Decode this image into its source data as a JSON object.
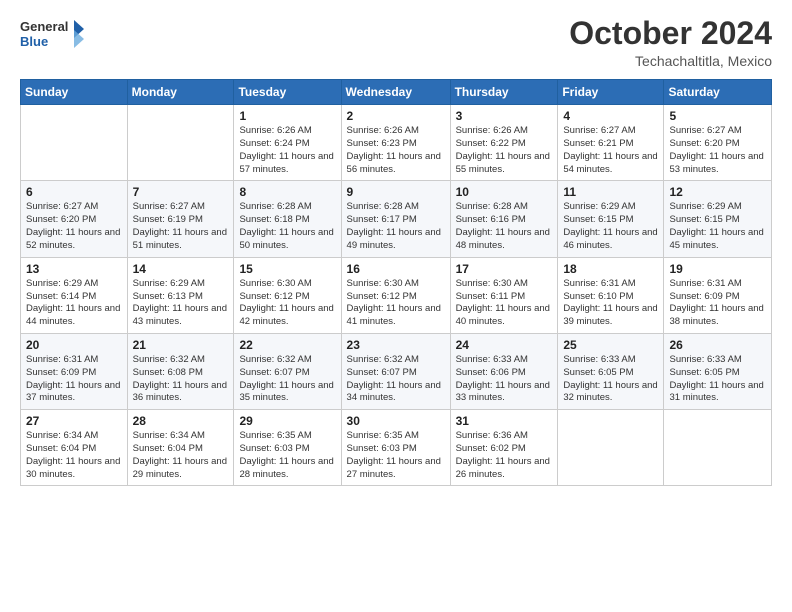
{
  "logo": {
    "line1": "General",
    "line2": "Blue"
  },
  "header": {
    "month": "October 2024",
    "location": "Techachaltitla, Mexico"
  },
  "weekdays": [
    "Sunday",
    "Monday",
    "Tuesday",
    "Wednesday",
    "Thursday",
    "Friday",
    "Saturday"
  ],
  "weeks": [
    [
      null,
      null,
      {
        "day": "1",
        "sunrise": "6:26 AM",
        "sunset": "6:24 PM",
        "daylight": "11 hours and 57 minutes."
      },
      {
        "day": "2",
        "sunrise": "6:26 AM",
        "sunset": "6:23 PM",
        "daylight": "11 hours and 56 minutes."
      },
      {
        "day": "3",
        "sunrise": "6:26 AM",
        "sunset": "6:22 PM",
        "daylight": "11 hours and 55 minutes."
      },
      {
        "day": "4",
        "sunrise": "6:27 AM",
        "sunset": "6:21 PM",
        "daylight": "11 hours and 54 minutes."
      },
      {
        "day": "5",
        "sunrise": "6:27 AM",
        "sunset": "6:20 PM",
        "daylight": "11 hours and 53 minutes."
      }
    ],
    [
      {
        "day": "6",
        "sunrise": "6:27 AM",
        "sunset": "6:20 PM",
        "daylight": "11 hours and 52 minutes."
      },
      {
        "day": "7",
        "sunrise": "6:27 AM",
        "sunset": "6:19 PM",
        "daylight": "11 hours and 51 minutes."
      },
      {
        "day": "8",
        "sunrise": "6:28 AM",
        "sunset": "6:18 PM",
        "daylight": "11 hours and 50 minutes."
      },
      {
        "day": "9",
        "sunrise": "6:28 AM",
        "sunset": "6:17 PM",
        "daylight": "11 hours and 49 minutes."
      },
      {
        "day": "10",
        "sunrise": "6:28 AM",
        "sunset": "6:16 PM",
        "daylight": "11 hours and 48 minutes."
      },
      {
        "day": "11",
        "sunrise": "6:29 AM",
        "sunset": "6:15 PM",
        "daylight": "11 hours and 46 minutes."
      },
      {
        "day": "12",
        "sunrise": "6:29 AM",
        "sunset": "6:15 PM",
        "daylight": "11 hours and 45 minutes."
      }
    ],
    [
      {
        "day": "13",
        "sunrise": "6:29 AM",
        "sunset": "6:14 PM",
        "daylight": "11 hours and 44 minutes."
      },
      {
        "day": "14",
        "sunrise": "6:29 AM",
        "sunset": "6:13 PM",
        "daylight": "11 hours and 43 minutes."
      },
      {
        "day": "15",
        "sunrise": "6:30 AM",
        "sunset": "6:12 PM",
        "daylight": "11 hours and 42 minutes."
      },
      {
        "day": "16",
        "sunrise": "6:30 AM",
        "sunset": "6:12 PM",
        "daylight": "11 hours and 41 minutes."
      },
      {
        "day": "17",
        "sunrise": "6:30 AM",
        "sunset": "6:11 PM",
        "daylight": "11 hours and 40 minutes."
      },
      {
        "day": "18",
        "sunrise": "6:31 AM",
        "sunset": "6:10 PM",
        "daylight": "11 hours and 39 minutes."
      },
      {
        "day": "19",
        "sunrise": "6:31 AM",
        "sunset": "6:09 PM",
        "daylight": "11 hours and 38 minutes."
      }
    ],
    [
      {
        "day": "20",
        "sunrise": "6:31 AM",
        "sunset": "6:09 PM",
        "daylight": "11 hours and 37 minutes."
      },
      {
        "day": "21",
        "sunrise": "6:32 AM",
        "sunset": "6:08 PM",
        "daylight": "11 hours and 36 minutes."
      },
      {
        "day": "22",
        "sunrise": "6:32 AM",
        "sunset": "6:07 PM",
        "daylight": "11 hours and 35 minutes."
      },
      {
        "day": "23",
        "sunrise": "6:32 AM",
        "sunset": "6:07 PM",
        "daylight": "11 hours and 34 minutes."
      },
      {
        "day": "24",
        "sunrise": "6:33 AM",
        "sunset": "6:06 PM",
        "daylight": "11 hours and 33 minutes."
      },
      {
        "day": "25",
        "sunrise": "6:33 AM",
        "sunset": "6:05 PM",
        "daylight": "11 hours and 32 minutes."
      },
      {
        "day": "26",
        "sunrise": "6:33 AM",
        "sunset": "6:05 PM",
        "daylight": "11 hours and 31 minutes."
      }
    ],
    [
      {
        "day": "27",
        "sunrise": "6:34 AM",
        "sunset": "6:04 PM",
        "daylight": "11 hours and 30 minutes."
      },
      {
        "day": "28",
        "sunrise": "6:34 AM",
        "sunset": "6:04 PM",
        "daylight": "11 hours and 29 minutes."
      },
      {
        "day": "29",
        "sunrise": "6:35 AM",
        "sunset": "6:03 PM",
        "daylight": "11 hours and 28 minutes."
      },
      {
        "day": "30",
        "sunrise": "6:35 AM",
        "sunset": "6:03 PM",
        "daylight": "11 hours and 27 minutes."
      },
      {
        "day": "31",
        "sunrise": "6:36 AM",
        "sunset": "6:02 PM",
        "daylight": "11 hours and 26 minutes."
      },
      null,
      null
    ]
  ],
  "labels": {
    "sunrise": "Sunrise:",
    "sunset": "Sunset:",
    "daylight": "Daylight:"
  }
}
